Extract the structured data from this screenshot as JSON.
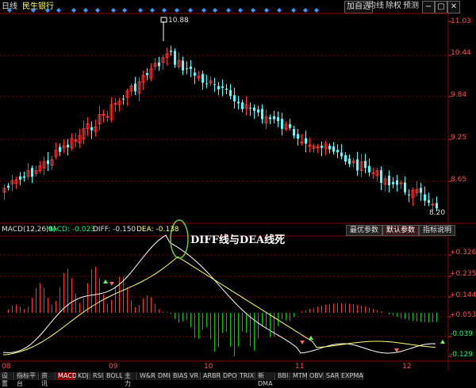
{
  "header": {
    "period": "日线",
    "stock_name": "民生银行",
    "buttons": [
      "加自选",
      "均线",
      "除权",
      "预测"
    ],
    "window_icons": [
      "minimize-icon",
      "restore-icon",
      "close-icon"
    ]
  },
  "price_axis": {
    "ticks": [
      "11.03",
      "10.44",
      "9.84",
      "9.25",
      "8.65"
    ],
    "high_label": "10.88",
    "low_label": "8.20"
  },
  "macd_panel": {
    "title": "MACD(12,26,9)",
    "macd": "MACD: -0.023",
    "diff": "DIFF: -0.150",
    "dea": "DEA: -0.138",
    "annotation": "DIFF线与DEA线死",
    "buttons": [
      "最优参数",
      "默认参数",
      "指标说明"
    ],
    "active_button": 1,
    "ticks": [
      "+0.326",
      "+0.235",
      "+0.144",
      "+0.053",
      "-0.039",
      "-0.129"
    ]
  },
  "date_labels": [
    "08",
    "09",
    "10",
    "11",
    "12"
  ],
  "bottom_tabs": [
    "设置",
    "指标平台",
    "资讯",
    "MACD",
    "KDJ",
    "RSI",
    "BOLL",
    "主力",
    "W&R",
    "DMI",
    "BIAS",
    "VR",
    "ARBR",
    "DPO",
    "TRIX",
    "新DMA",
    "BBI",
    "MTM",
    "OBV",
    "SAR",
    "EXPMA"
  ],
  "active_tab": 3,
  "colors": {
    "up": "#ff3232",
    "down": "#54ffff",
    "diff_line": "#ffffff",
    "dea_line": "#ffff66",
    "grid": "#8b0000",
    "neg_hist": "#00c800",
    "circle": "#66cc33"
  }
}
